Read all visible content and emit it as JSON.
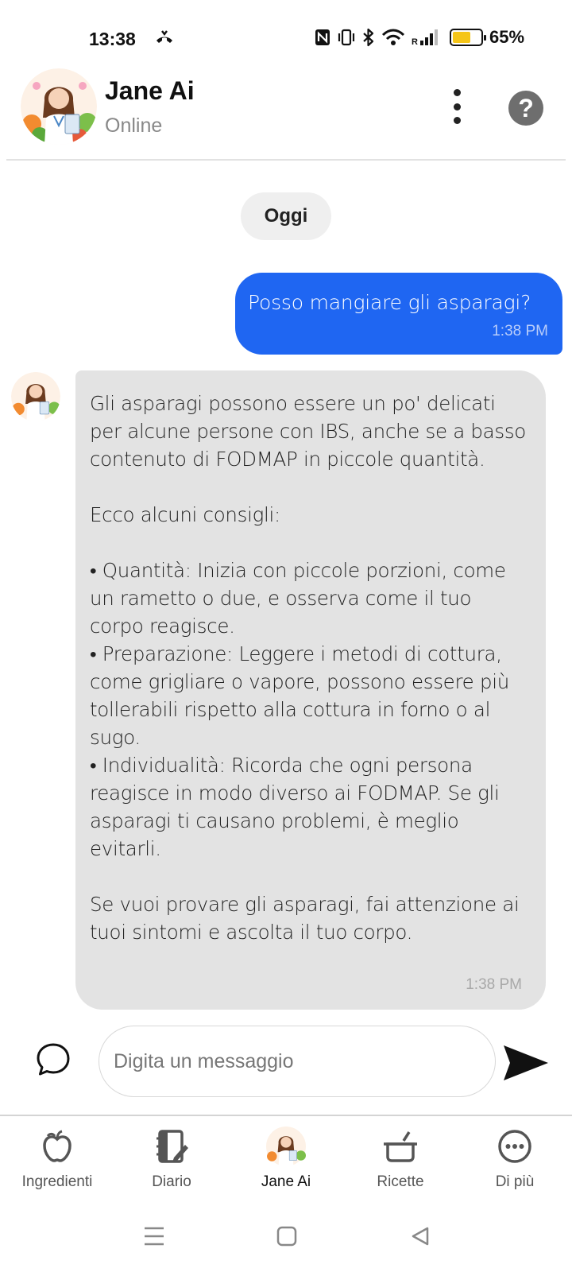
{
  "status_bar": {
    "time": "13:38",
    "battery_percent": "65%",
    "battery_level": 0.65
  },
  "header": {
    "name": "Jane Ai",
    "status": "Online",
    "avatar_icon": "doctor-avatar",
    "more_icon": "more-vertical-icon",
    "help_icon": "help-icon",
    "help_glyph": "?"
  },
  "chat": {
    "date_label": "Oggi",
    "messages": [
      {
        "sender": "user",
        "text": "Posso mangiare gli asparagi?",
        "time": "1:38 PM"
      },
      {
        "sender": "bot",
        "text": "Gli asparagi possono essere un po' delicati per alcune persone con IBS, anche se a basso contenuto di FODMAP in piccole quantità.\n\nEcco alcuni consigli:\n\n• Quantità: Inizia con piccole porzioni, come un rametto o due, e osserva come il tuo corpo reagisce.\n• Preparazione:  Leggere i metodi di cottura, come grigliare o vapore, possono essere più tollerabili rispetto alla cottura in forno o al sugo.\n• Individualità: Ricorda che ogni persona reagisce in modo diverso ai FODMAP. Se gli asparagi ti causano problemi, è meglio evitarli.\n\nSe vuoi provare gli asparagi, fai attenzione ai tuoi sintomi e ascolta il tuo corpo.",
        "time": "1:38 PM"
      }
    ]
  },
  "composer": {
    "placeholder": "Digita un messaggio",
    "value": ""
  },
  "bottom_nav": {
    "items": [
      {
        "label": "Ingredienti",
        "icon": "apple-icon"
      },
      {
        "label": "Diario",
        "icon": "diary-icon"
      },
      {
        "label": "Jane Ai",
        "icon": "jane-avatar-icon",
        "active": true
      },
      {
        "label": "Ricette",
        "icon": "pot-icon"
      },
      {
        "label": "Di più",
        "icon": "more-circle-icon"
      }
    ]
  },
  "colors": {
    "user_bubble": "#1f66f2",
    "bot_bubble": "#e3e3e3",
    "battery": "#f5c518"
  }
}
